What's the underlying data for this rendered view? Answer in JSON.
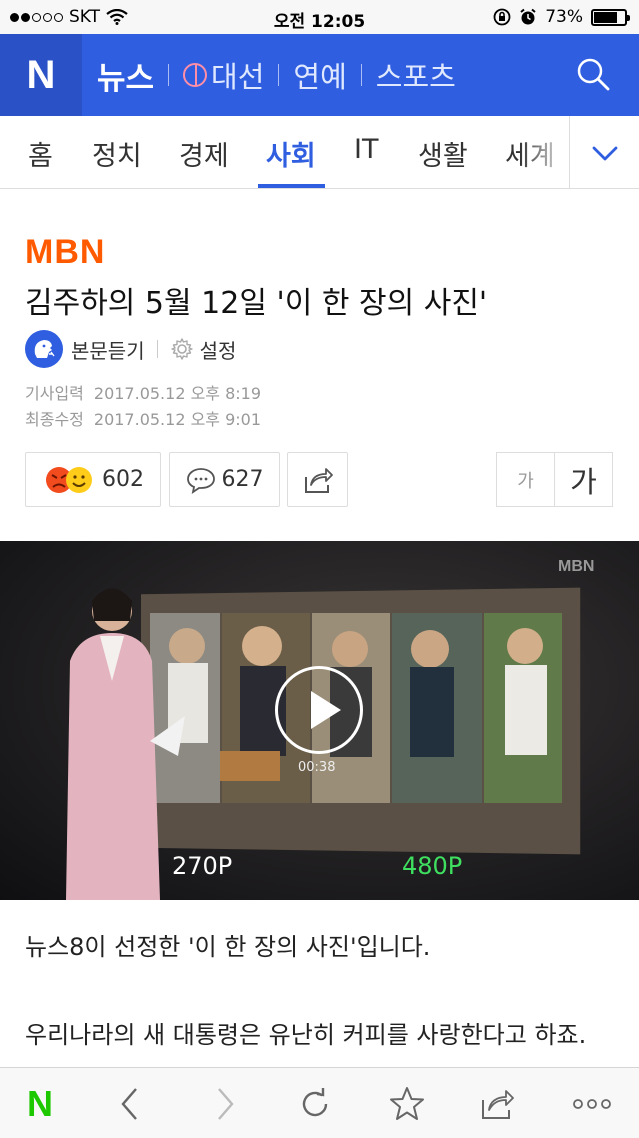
{
  "status_bar": {
    "carrier": "SKT",
    "time": "오전 12:05",
    "battery": "73%"
  },
  "header": {
    "logo": "N",
    "nav": [
      {
        "label": "뉴스"
      },
      {
        "label": "대선"
      },
      {
        "label": "연예"
      },
      {
        "label": "스포츠"
      }
    ]
  },
  "tabs": [
    {
      "label": "홈"
    },
    {
      "label": "정치"
    },
    {
      "label": "경제"
    },
    {
      "label": "사회"
    },
    {
      "label": "IT"
    },
    {
      "label": "생활"
    },
    {
      "label": "세계"
    }
  ],
  "article": {
    "source": "MBN",
    "title": "김주하의 5월 12일 '이 한 장의 사진'",
    "tts_label": "본문듣기",
    "settings_label": "설정",
    "published_key": "기사입력",
    "published_value": "2017.05.12 오후 8:19",
    "updated_key": "최종수정",
    "updated_value": "2017.05.12 오후 9:01",
    "reactions": "602",
    "comments": "627",
    "font_small": "가",
    "font_large": "가"
  },
  "video": {
    "watermark": "MBN",
    "duration": "00:38",
    "quality_low": "270P",
    "quality_high": "480P"
  },
  "body": [
    "뉴스8이 선정한 '이 한 장의 사진'입니다.",
    "우리나라의 새 대통령은 유난히 커피를 사랑한다고 하죠."
  ],
  "colors": {
    "header_blue": "#2f5ee0",
    "accent_orange": "#ff5a00",
    "hd_green": "#3fe060",
    "naver_green": "#1ec800"
  }
}
